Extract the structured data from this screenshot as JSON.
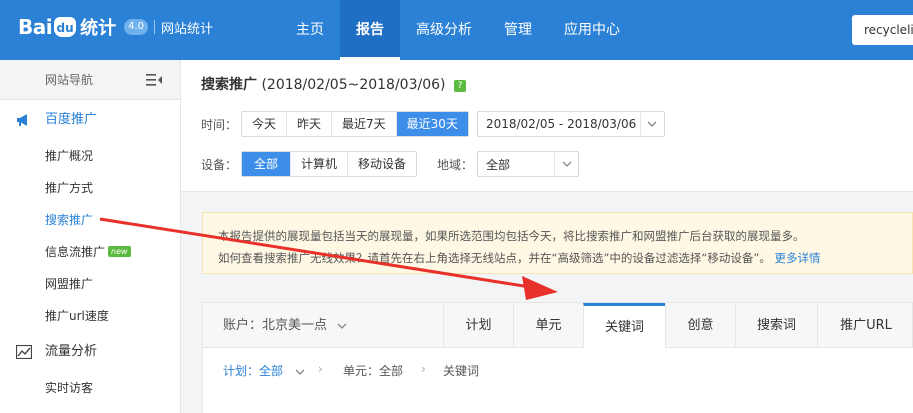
{
  "header": {
    "logo_text": "Bai",
    "logo_paw": "du",
    "logo_product": "统计",
    "logo_version": "4.0",
    "logo_site": "网站统计",
    "nav": [
      "主页",
      "报告",
      "高级分析",
      "管理",
      "应用中心"
    ],
    "active_nav": "报告",
    "account": "recyclelife"
  },
  "sidebar": {
    "title": "网站导航",
    "group1": {
      "label": "百度推广",
      "icon": "megaphone-icon"
    },
    "items": [
      "推广概况",
      "推广方式",
      "搜索推广",
      "信息流推广",
      "网盟推广",
      "推广url速度"
    ],
    "new_badge": "new",
    "group2": {
      "label": "流量分析",
      "icon": "chart-icon"
    },
    "items2": [
      "实时访客"
    ]
  },
  "filters": {
    "title": "搜索推广",
    "date_range": "(2018/02/05~2018/03/06)",
    "help": "?",
    "time_label": "时间：",
    "time_options": [
      "今天",
      "昨天",
      "最近7天",
      "最近30天"
    ],
    "time_active": "最近30天",
    "date_picker": "2018/02/05 - 2018/03/06",
    "device_label": "设备：",
    "device_options": [
      "全部",
      "计算机",
      "移动设备"
    ],
    "device_active": "全部",
    "region_label": "地域：",
    "region_value": "全部"
  },
  "notice": {
    "line1": "本报告提供的展现量包括当天的展现量，如果所选范围均包括今天，将比搜索推广和网盟推广后台获取的展现量多。",
    "line2": "如何查看搜索推广无线效果？请首先在右上角选择无线站点，并在“高级筛选”中的设备过滤选择“移动设备”。",
    "more_link": "更多详情"
  },
  "tabs": {
    "account": "账户：北京美一点",
    "items": [
      "计划",
      "单元",
      "关键词",
      "创意",
      "搜索词",
      "推广URL"
    ],
    "active": "关键词"
  },
  "breadcrumb": {
    "plan": "计划：全部",
    "unit": "单元：全部",
    "current": "关键词"
  },
  "colors": {
    "brand": "#2a81d6",
    "active_option": "#3d8ee8",
    "annotation_arrow": "#e8312a"
  }
}
